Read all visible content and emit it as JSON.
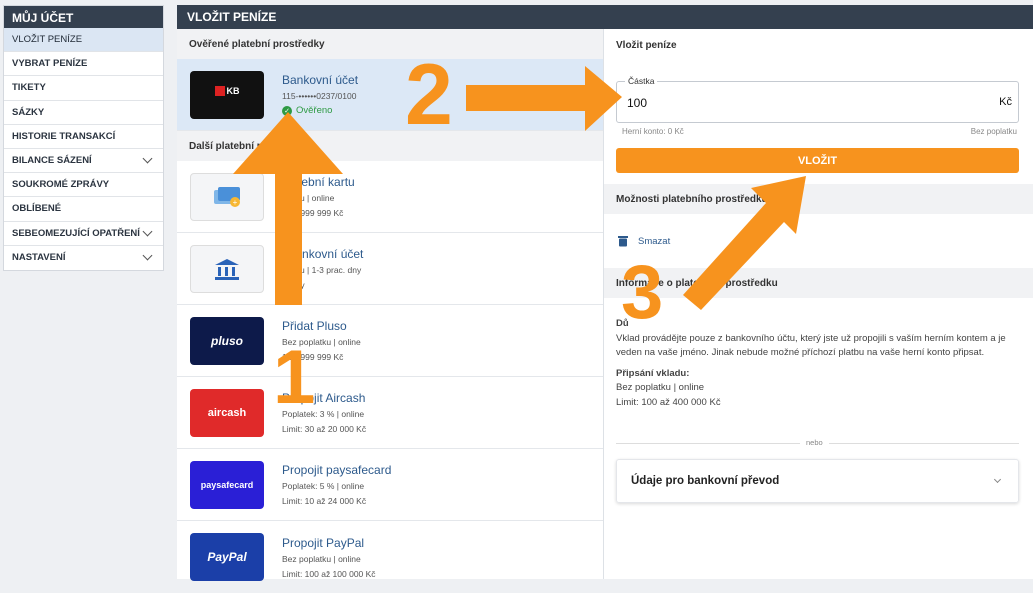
{
  "sidebar": {
    "title": "MŮJ ÚČET",
    "items": [
      {
        "label": "VLOŽIT PENÍZE",
        "active": true,
        "chevron": false
      },
      {
        "label": "VYBRAT PENÍZE",
        "chevron": false
      },
      {
        "label": "TIKETY",
        "chevron": false
      },
      {
        "label": "SÁZKY",
        "chevron": false
      },
      {
        "label": "HISTORIE TRANSAKCÍ",
        "chevron": false
      },
      {
        "label": "BILANCE SÁZENÍ",
        "chevron": true
      },
      {
        "label": "SOUKROMÉ ZPRÁVY",
        "chevron": false
      },
      {
        "label": "OBLÍBENÉ",
        "chevron": false
      },
      {
        "label": "SEBEOMEZUJÍCÍ OPATŘENÍ",
        "chevron": true
      },
      {
        "label": "NASTAVENÍ",
        "chevron": true
      }
    ]
  },
  "main": {
    "title": "VLOŽIT PENÍZE",
    "verified_heading": "Ověřené platební prostředky",
    "verified": {
      "title": "Bankovní účet",
      "account": "115-••••••0237/0100",
      "status": "Ověřeno",
      "logo_text": "KB"
    },
    "other_heading": "Další platební pros",
    "methods": [
      {
        "title": "platební kartu",
        "line1": "platku | online",
        "line2": "0 až 999 999 Kč",
        "logo": "card-icon"
      },
      {
        "title": "t bankovní účet",
        "line1": "platku | 1-3 prac. dny",
        "line2": "banky",
        "logo": "bank-icon"
      },
      {
        "title": "Přidat Pluso",
        "line1": "Bez poplatku | online",
        "line2": "1 až 999 999 Kč",
        "logo_text": "pluso",
        "color": "#0d1a4a"
      },
      {
        "title": "Propojit Aircash",
        "line1": "Poplatek: 3 % | online",
        "line2": "Limit: 30 až 20 000 Kč",
        "logo_text": "aircash",
        "color": "#e02a2a"
      },
      {
        "title": "Propojit paysafecard",
        "line1": "Poplatek: 5 % | online",
        "line2": "Limit: 10 až 24 000 Kč",
        "logo_text": "paysafecard",
        "color": "#2a1fd6"
      },
      {
        "title": "Propojit PayPal",
        "line1": "Bez poplatku | online",
        "line2": "Limit: 100 až 100 000 Kč",
        "logo_text": "PayPal",
        "color": "#1b3fa8"
      }
    ]
  },
  "deposit": {
    "heading": "Vložit peníze",
    "legend": "Částka",
    "amount": "100",
    "currency": "Kč",
    "game_account": "Herní konto: 0 Kč",
    "fee": "Bez poplatku",
    "button": "VLOŽIT",
    "options_heading": "Možnosti platebního prostředku",
    "delete": "Smazat",
    "info_heading": "Informace o platebním prostředku",
    "info_title": "Dů",
    "info_text": "Vklad provádějte pouze z bankovního účtu, který jste už propojili s vaším herním kontem a je veden na vaše jméno. Jinak nebude možné příchozí platbu na vaše herní konto připsat.",
    "credit_title": "Připsání vkladu:",
    "credit_line1": "Bez poplatku | online",
    "credit_line2": "Limit: 100 až 400 000 Kč",
    "or": "nebo",
    "bank_transfer": "Údaje pro bankovní převod"
  },
  "annotations": {
    "n1": "1",
    "n2": "2",
    "n3": "3",
    "color": "#f7931e"
  }
}
